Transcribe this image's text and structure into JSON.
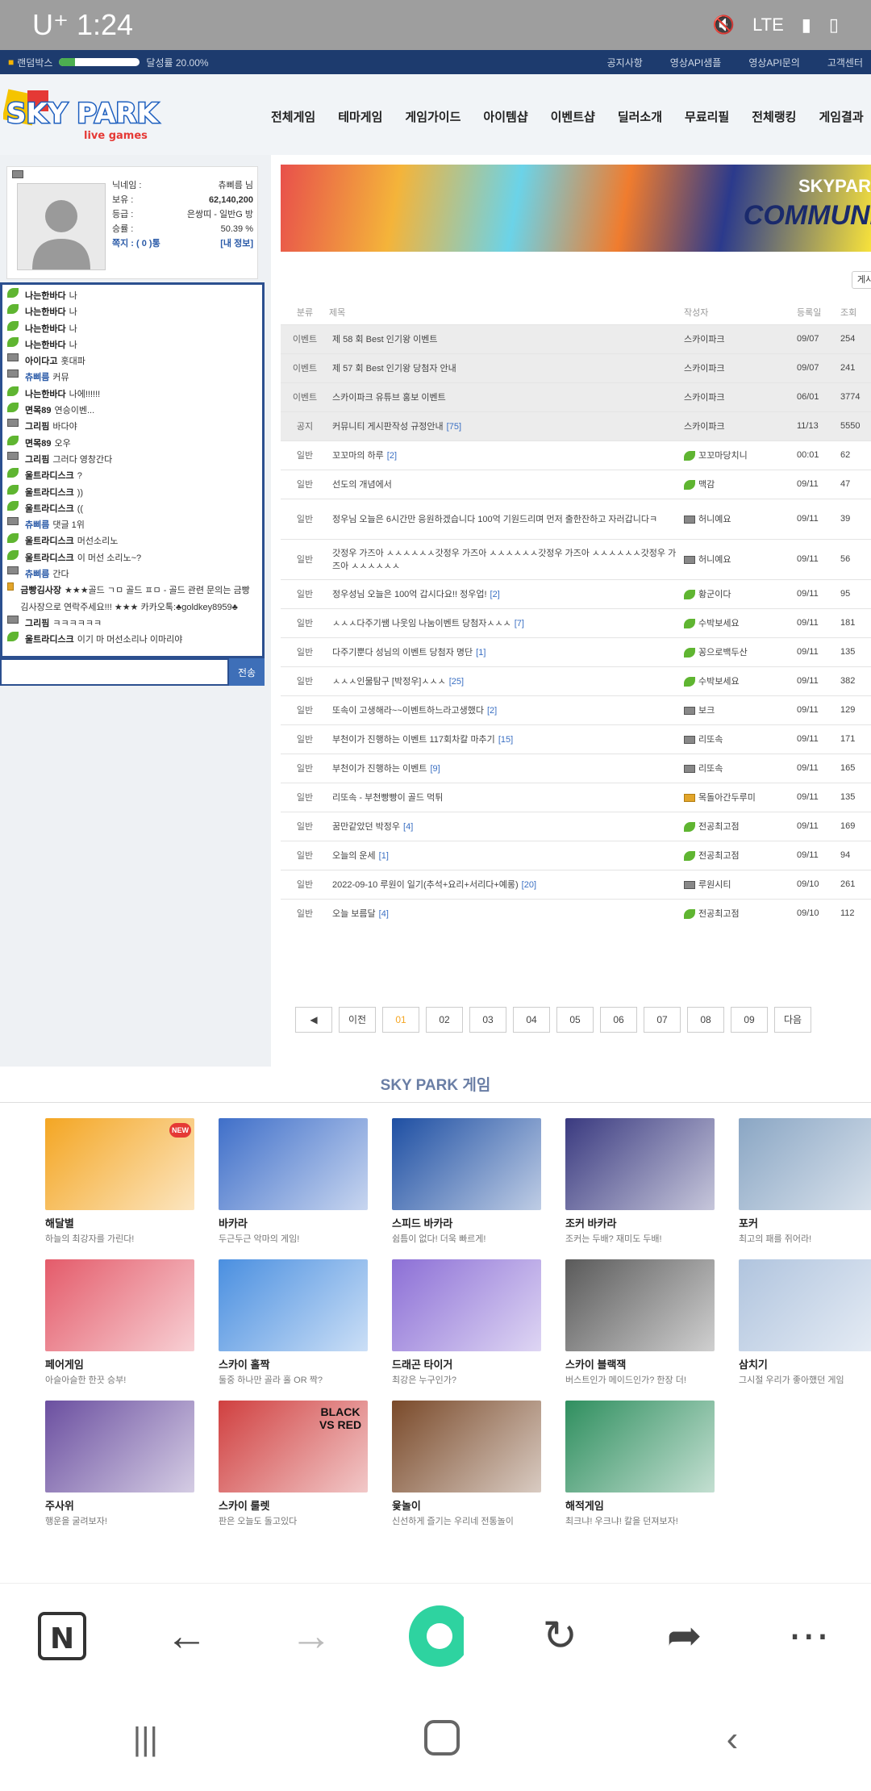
{
  "status_bar": {
    "carrier_time": "U⁺ 1:24",
    "network": "LTE"
  },
  "topbar": {
    "randombox": "랜덤박스",
    "achievement": "달성률 20.00%",
    "progress": 0.2,
    "links": [
      "공지사항",
      "영상API샘플",
      "영상API문의",
      "고객센터"
    ]
  },
  "header": {
    "logo_top": "SKY PARK",
    "logo_sub": "live games",
    "nav": [
      "전체게임",
      "테마게임",
      "게임가이드",
      "아이템샵",
      "이벤트샵",
      "딜러소개",
      "무료리필",
      "전체랭킹",
      "게임결과"
    ]
  },
  "profile": {
    "nick_label": "닉네임 :",
    "nick": "츄삐름 님",
    "hold_label": "보유 :",
    "hold": "62,140,200",
    "grade_label": "등급 :",
    "grade": "은쌍띠 - 일반G 방",
    "winrate_label": "승률 :",
    "winrate": "50.39 %",
    "note": "쪽지 : ( 0 )통",
    "myinfo": "[내 정보]"
  },
  "chat": {
    "messages": [
      {
        "icon": "leaf",
        "nick": "나는한바다",
        "text": "나"
      },
      {
        "icon": "leaf",
        "nick": "나는한바다",
        "text": "나"
      },
      {
        "icon": "leaf",
        "nick": "나는한바다",
        "text": "나"
      },
      {
        "icon": "leaf",
        "nick": "나는한바다",
        "text": "나"
      },
      {
        "icon": "badge",
        "nick": "아이다고",
        "text": "홋대파"
      },
      {
        "icon": "badge",
        "nick": "츄삐름",
        "text": "커뮤",
        "blue": true
      },
      {
        "icon": "leaf",
        "nick": "나는한바다",
        "text": "나에!!!!!!"
      },
      {
        "icon": "leaf",
        "nick": "면목89",
        "text": "연승이벤..."
      },
      {
        "icon": "badge",
        "nick": "그리핌",
        "text": "바다야"
      },
      {
        "icon": "leaf",
        "nick": "면목89",
        "text": "오우"
      },
      {
        "icon": "badge",
        "nick": "그리핌",
        "text": "그러다 영창간다"
      },
      {
        "icon": "leaf",
        "nick": "울트라디스크",
        "text": "?"
      },
      {
        "icon": "leaf",
        "nick": "울트라디스크",
        "text": "))"
      },
      {
        "icon": "leaf",
        "nick": "울트라디스크",
        "text": "(("
      },
      {
        "icon": "badge",
        "nick": "츄삐름",
        "text": "댓글 1위",
        "blue": true
      },
      {
        "icon": "leaf",
        "nick": "울트라디스크",
        "text": "머선소리노"
      },
      {
        "icon": "leaf",
        "nick": "울트라디스크",
        "text": "이 머선 소리노~?"
      },
      {
        "icon": "badge",
        "nick": "츄삐름",
        "text": "간다",
        "blue": true
      },
      {
        "icon": "gold",
        "nick": "금빵김사장",
        "text": "★★★골드 ㄱㅁ 골드 ㅍㅁ - 골드 관련 문의는 금빵김사장으로 연락주세요!!! ★★★ 카카오톡:♣goldkey8959♣"
      },
      {
        "icon": "badge",
        "nick": "그리핌",
        "text": "ㅋㅋㅋㅋㅋㅋ"
      },
      {
        "icon": "leaf",
        "nick": "울트라디스크",
        "text": "이기 마 머선소리나 이마리야"
      }
    ],
    "send": "전송"
  },
  "board": {
    "banner_brand": "SKYPAR",
    "banner_title": "COMMUNI",
    "write": "게시",
    "columns": [
      "분류",
      "제목",
      "작성자",
      "등록일",
      "조회"
    ],
    "rows": [
      {
        "cat": "이벤트",
        "title": "제 58 회 Best 인기왕 이벤트",
        "cmt": "",
        "author": "스카이파크",
        "icon": "",
        "date": "09/07",
        "views": "254",
        "notice": true
      },
      {
        "cat": "이벤트",
        "title": "제 57 회 Best 인기왕 당첨자 안내",
        "cmt": "",
        "author": "스카이파크",
        "icon": "",
        "date": "09/07",
        "views": "241",
        "notice": true
      },
      {
        "cat": "이벤트",
        "title": "스카이파크 유튜브 홍보 이벤트",
        "cmt": "",
        "author": "스카이파크",
        "icon": "",
        "date": "06/01",
        "views": "3774",
        "notice": true
      },
      {
        "cat": "공지",
        "title": "커뮤니티 게시판작성 규정안내",
        "cmt": "[75]",
        "author": "스카이파크",
        "icon": "",
        "date": "11/13",
        "views": "5550",
        "notice": true
      },
      {
        "cat": "일반",
        "title": "꼬꼬마의 하루",
        "cmt": "[2]",
        "author": "꼬꼬마당치니",
        "icon": "leaf",
        "date": "00:01",
        "views": "62"
      },
      {
        "cat": "일반",
        "title": "선도의 개념에서",
        "cmt": "",
        "author": "맥감",
        "icon": "leaf",
        "date": "09/11",
        "views": "47"
      },
      {
        "cat": "일반",
        "title": "정우님 오늘은 6시간만 응원하겠습니다 100억 기원드리며 먼저 출한잔하고 자러갑니다ㅋ",
        "cmt": "",
        "author": "허니예요",
        "icon": "badge",
        "date": "09/11",
        "views": "39",
        "tall": true
      },
      {
        "cat": "일반",
        "title": "갓정우 가즈아 ㅅㅅㅅㅅㅅㅅ갓정우 가즈아 ㅅㅅㅅㅅㅅㅅ갓정우 가즈아 ㅅㅅㅅㅅㅅㅅ갓정우 가즈아 ㅅㅅㅅㅅㅅㅅ",
        "cmt": "",
        "author": "허니예요",
        "icon": "badge",
        "date": "09/11",
        "views": "56",
        "tall": true
      },
      {
        "cat": "일반",
        "title": "정우성님 오늘은 100억 갑시다요!! 정우업!",
        "cmt": "[2]",
        "author": "황군이다",
        "icon": "leaf",
        "date": "09/11",
        "views": "95"
      },
      {
        "cat": "일반",
        "title": "ㅅㅅㅅ다주기쌤 나웃임 나눔이벤트 당첨자ㅅㅅㅅ",
        "cmt": "[7]",
        "author": "수박보세요",
        "icon": "leaf",
        "date": "09/11",
        "views": "181"
      },
      {
        "cat": "일반",
        "title": "다주기뿐다 성님의 이벤트 당첨자 명단",
        "cmt": "[1]",
        "author": "꽁으로백두산",
        "icon": "leaf",
        "date": "09/11",
        "views": "135"
      },
      {
        "cat": "일반",
        "title": "ㅅㅅㅅ인물탐구 [박정우]ㅅㅅㅅ",
        "cmt": "[25]",
        "author": "수박보세요",
        "icon": "leaf",
        "date": "09/11",
        "views": "382"
      },
      {
        "cat": "일반",
        "title": "또속이 고생해라~~이벤트하느라고생했다",
        "cmt": "[2]",
        "author": "보크",
        "icon": "badge",
        "date": "09/11",
        "views": "129"
      },
      {
        "cat": "일반",
        "title": "부천이가 진행하는 이벤트 117회차칼 마추기",
        "cmt": "[15]",
        "author": "리또속",
        "icon": "badge",
        "date": "09/11",
        "views": "171"
      },
      {
        "cat": "일반",
        "title": "부천이가 진행하는 이벤트",
        "cmt": "[9]",
        "author": "리또속",
        "icon": "badge",
        "date": "09/11",
        "views": "165"
      },
      {
        "cat": "일반",
        "title": "리또속 - 부천빵빵이 골드 먹튀",
        "cmt": "",
        "author": "목돌아간두루미",
        "icon": "gold",
        "date": "09/11",
        "views": "135"
      },
      {
        "cat": "일반",
        "title": "꿈만같았던 박정우",
        "cmt": "[4]",
        "author": "전공최고점",
        "icon": "leaf",
        "date": "09/11",
        "views": "169"
      },
      {
        "cat": "일반",
        "title": "오늘의 운세",
        "cmt": "[1]",
        "author": "전공최고점",
        "icon": "leaf",
        "date": "09/11",
        "views": "94"
      },
      {
        "cat": "일반",
        "title": "2022-09-10 루원이 일기(추석+요리+서리다+예롱)",
        "cmt": "[20]",
        "author": "루원시티",
        "icon": "badge",
        "date": "09/10",
        "views": "261"
      },
      {
        "cat": "일반",
        "title": "오늘 보름달",
        "cmt": "[4]",
        "author": "전공최고점",
        "icon": "leaf",
        "date": "09/10",
        "views": "112"
      }
    ],
    "pager": {
      "prev_arrow": "◀",
      "prev": "이전",
      "pages": [
        "01",
        "02",
        "03",
        "04",
        "05",
        "06",
        "07",
        "08",
        "09"
      ],
      "next": "다음",
      "current": "01"
    }
  },
  "games": {
    "title": "SKY PARK 게임",
    "items": [
      {
        "name": "해달별",
        "desc": "하늘의 최강자를 가린다!",
        "color": "#f4a623",
        "badge": "NEW"
      },
      {
        "name": "바카라",
        "desc": "두근두근 악마의 게임!",
        "color": "#3f6fc9"
      },
      {
        "name": "스피드 바카라",
        "desc": "쉼틈이 없다! 더욱 빠르게!",
        "color": "#1e4fa3"
      },
      {
        "name": "조커 바카라",
        "desc": "조커는 두배? 재미도 두배!",
        "color": "#3a3a80"
      },
      {
        "name": "포커",
        "desc": "최고의 패를 쥐어라!",
        "color": "#8aa6c4"
      },
      {
        "name": "페어게임",
        "desc": "아슬아슬한 한끗 승부!",
        "color": "#e45b6a"
      },
      {
        "name": "스카이 홀짝",
        "desc": "둘중 하나만 골라 홀 OR 짝?",
        "color": "#4a8fe0"
      },
      {
        "name": "드래곤 타이거",
        "desc": "최강은 누구인가?",
        "color": "#8c6fd6"
      },
      {
        "name": "스카이 블랙잭",
        "desc": "버스트인가 메이드인가? 한장 더!",
        "color": "#5a5a5a"
      },
      {
        "name": "삼치기",
        "desc": "그시절 우리가 좋아했던 게임",
        "color": "#b0c4de"
      },
      {
        "name": "주사위",
        "desc": "행운을 굴려보자!",
        "color": "#6b4fa0"
      },
      {
        "name": "스카이 룰렛",
        "desc": "판은 오늘도 돌고있다",
        "color": "#d04040",
        "tag": "BLACK VS RED"
      },
      {
        "name": "윷놀이",
        "desc": "신선하게 즐기는 우리네 전통놀이",
        "color": "#7a4a2a"
      },
      {
        "name": "해적게임",
        "desc": "최크냐! 우크냐! 칼을 던져보자!",
        "color": "#2f8f5f"
      }
    ]
  }
}
